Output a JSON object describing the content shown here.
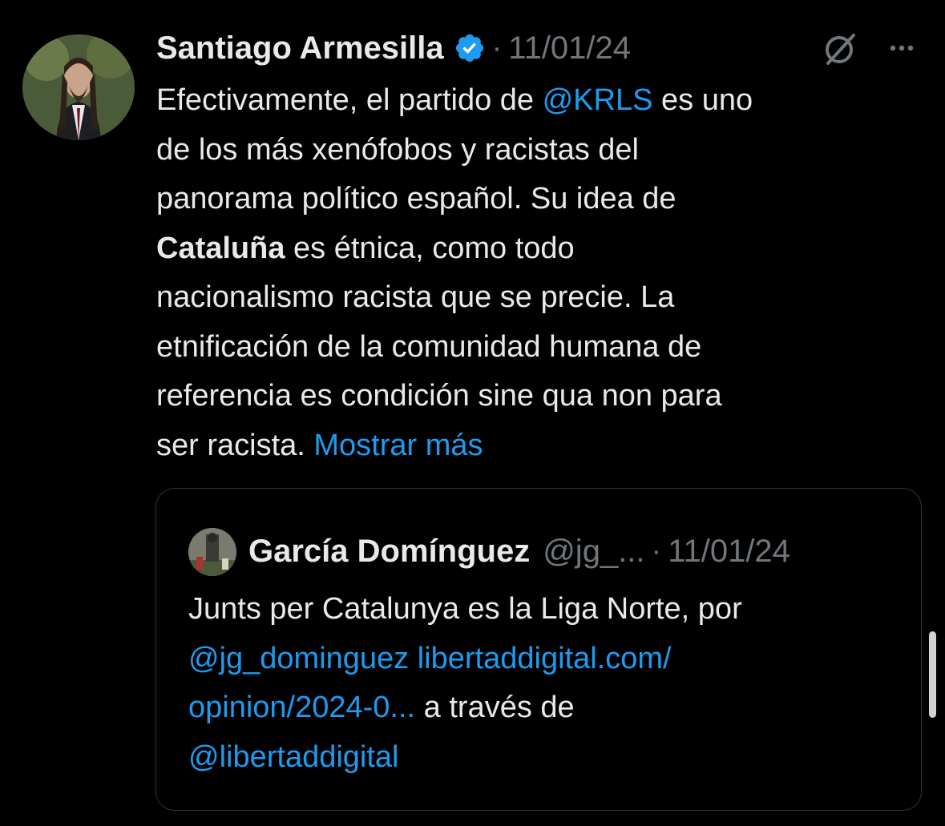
{
  "tweet": {
    "author_name": "Santiago Armesilla",
    "separator": "·",
    "date": "11/01/24",
    "verified": true,
    "icons": [
      "verified-badge-icon",
      "grok-icon",
      "more-options-icon"
    ],
    "lines": {
      "l1_a": "Efectivamente, el partido de ",
      "l1_link": "@KRLS",
      "l1_b": " es uno",
      "l2": "de los más xenófobos y racistas del",
      "l3": "panorama político español. Su idea de",
      "l4_bold": "Cataluña",
      "l4_b": " es étnica, como todo",
      "l5": "nacionalismo racista que se precie. La",
      "l6": "etnificación de la comunidad humana de",
      "l7": "referencia es condición sine qua non para",
      "l8_a": "ser racista. ",
      "l8_link": "Mostrar más"
    }
  },
  "quoted_tweet": {
    "author_name": "García Domínguez",
    "handle": "@jg_...",
    "separator": "·",
    "date": "11/01/24",
    "lines": {
      "l1": "Junts per Catalunya es la Liga Norte, por",
      "l2_link": "@jg_dominguez libertaddigital.com/",
      "l3_link": "opinion/2024-0...",
      "l3_b": " a través de",
      "l4_link": "@libertaddigital"
    }
  },
  "colors": {
    "background": "#000000",
    "text": "#e7e9ea",
    "secondary": "#71767b",
    "link": "#1d9bf0",
    "border": "#2f3336"
  }
}
